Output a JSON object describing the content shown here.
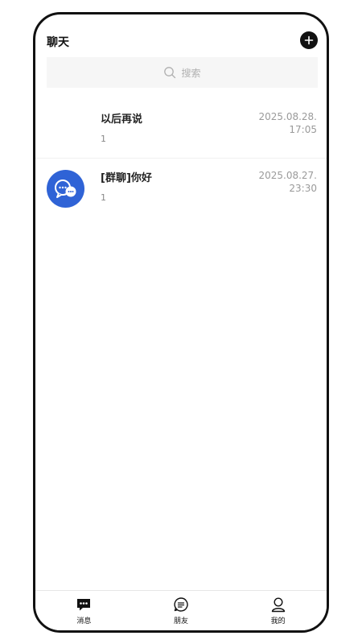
{
  "header": {
    "title": "聊天",
    "add_icon": "plus-circle-icon"
  },
  "search": {
    "placeholder": "搜索",
    "icon": "search-icon"
  },
  "chats": [
    {
      "name": "以后再说",
      "preview": "1",
      "time_date": "2025.08.28.",
      "time_clock": "17:05",
      "has_avatar": false
    },
    {
      "name": "[群聊]你好",
      "preview": "1",
      "time_date": "2025.08.27.",
      "time_clock": "23:30",
      "has_avatar": true,
      "avatar_color": "#2f63d6"
    }
  ],
  "tabbar": {
    "items": [
      {
        "label": "消息",
        "icon": "chat-bubble-icon",
        "active": true
      },
      {
        "label": "朋友",
        "icon": "note-icon",
        "active": false
      },
      {
        "label": "我的",
        "icon": "user-icon",
        "active": false
      }
    ]
  }
}
